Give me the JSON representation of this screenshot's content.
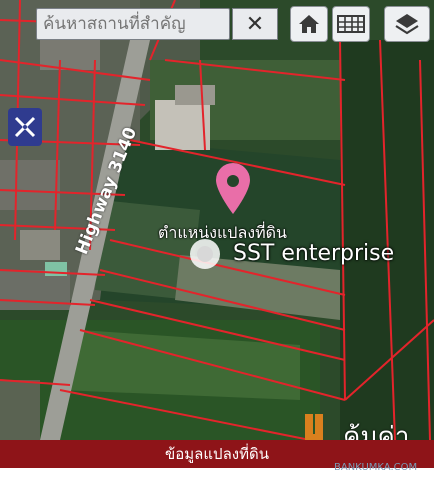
{
  "search": {
    "placeholder": "ค้นหาสถานที่สำคัญ",
    "value": ""
  },
  "toolbar": {
    "clear_icon": "close-icon",
    "home_icon": "home-icon",
    "grid_icon": "grid-table-icon",
    "layers_icon": "layers-icon",
    "draw_icon": "ruler-pencil-icon"
  },
  "map": {
    "pin_label": "ตำแหน่งแปลงที่ดิน",
    "poi_label": "SST enterprise",
    "road_label": "Highway 3140",
    "pin_color": "#e96ea8",
    "parcel_line_color": "#e3242b"
  },
  "bottom_bar": {
    "label": "ข้อมูลแปลงที่ดิน",
    "color": "#8e1418"
  },
  "watermark": {
    "title": "คุ้มค่า",
    "subtitle": "BANKUMKA.COM"
  }
}
